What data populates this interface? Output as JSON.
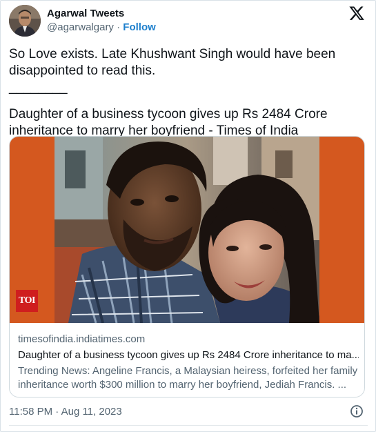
{
  "author": {
    "display_name": "Agarwal Tweets",
    "handle": "@agarwalgary",
    "separator": "·",
    "follow_label": "Follow"
  },
  "tweet": {
    "text_line": "So Love exists. Late Khushwant Singh would have been disappointed to read this.",
    "separator_line": "________",
    "headline": "Daughter of a business tycoon gives up Rs 2484 Crore inheritance to marry her boyfriend - Times of India"
  },
  "link_card": {
    "logo_text": "TOI",
    "domain": "timesofindia.indiatimes.com",
    "title": "Daughter of a business tycoon gives up Rs 2484 Crore inheritance to ma...",
    "description": "Trending News: Angeline Francis, a Malaysian heiress, forfeited her family inheritance worth $300 million to marry her boyfriend, Jediah Francis. ...",
    "background_color": "#d4581f"
  },
  "footer": {
    "timestamp": "11:58 PM · Aug 11, 2023"
  },
  "icons": {
    "platform": "x-logo-icon",
    "info": "info-icon"
  }
}
